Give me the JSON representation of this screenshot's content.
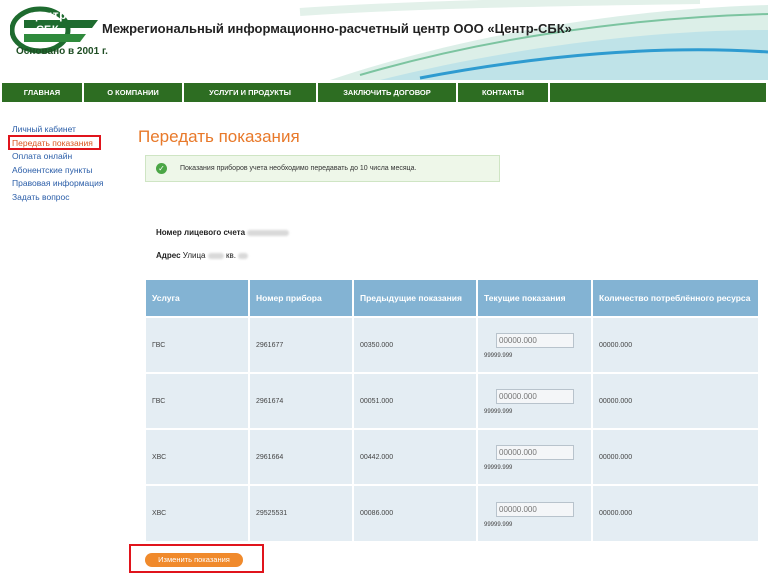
{
  "brand": {
    "logo_line1": "центр",
    "logo_line2": "СБК",
    "since": "Основано в 2001 г.",
    "site_title": "Межрегиональный информационно-расчетный центр ООО «Центр-СБК»",
    "green": "#2d6d22"
  },
  "nav": {
    "items": [
      "ГЛАВНАЯ",
      "О КОМПАНИИ",
      "УСЛУГИ И ПРОДУКТЫ",
      "ЗАКЛЮЧИТЬ ДОГОВОР",
      "КОНТАКТЫ"
    ]
  },
  "sidebar": {
    "items": [
      "Личный кабинет",
      "Передать показания",
      "Оплата онлайн",
      "Абонентские пункты",
      "Правовая информация",
      "Задать вопрос"
    ],
    "active": "Передать показания"
  },
  "page": {
    "title": "Передать показания",
    "notice": "Показания приборов учета необходимо передавать до 10 числа месяца.",
    "account_label": "Номер лицевого счета",
    "address_label": "Адрес",
    "address_value_prefix": "Улица",
    "address_kv": "кв."
  },
  "table": {
    "headers": [
      "Услуга",
      "Номер прибора",
      "Предыдущие показания",
      "Текущие показания",
      "Количество потреблённого ресурса"
    ],
    "rows": [
      {
        "service": "ГВС",
        "meter": "2961677",
        "previous": "00350.000",
        "placeholder": "00000.000",
        "max": "99999.999",
        "amount": "00000.000"
      },
      {
        "service": "ГВС",
        "meter": "2961674",
        "previous": "00051.000",
        "placeholder": "00000.000",
        "max": "99999.999",
        "amount": "00000.000"
      },
      {
        "service": "ХВС",
        "meter": "2961664",
        "previous": "00442.000",
        "placeholder": "00000.000",
        "max": "99999.999",
        "amount": "00000.000"
      },
      {
        "service": "ХВС",
        "meter": "29525531",
        "previous": "00086.000",
        "placeholder": "00000.000",
        "max": "99999.999",
        "amount": "00000.000"
      }
    ]
  },
  "actions": {
    "change_button": "Изменить показания",
    "accent": "#f08a2c",
    "highlight": "#e0141c"
  }
}
